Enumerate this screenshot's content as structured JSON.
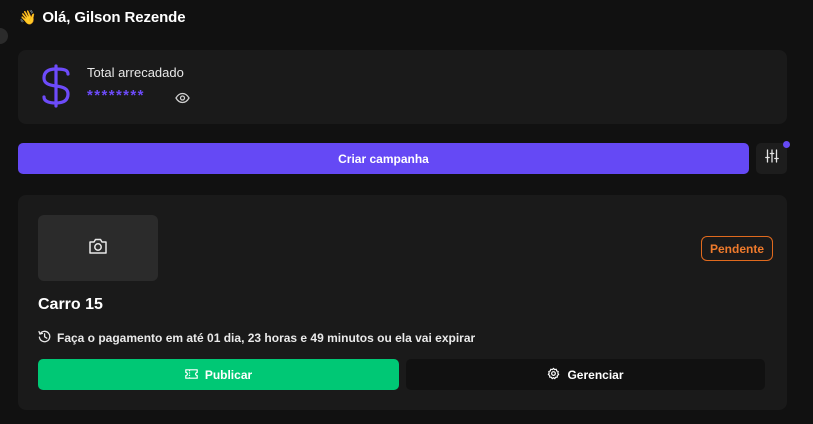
{
  "greeting": {
    "emoji": "👋",
    "text": "Olá, Gilson Rezende"
  },
  "balance": {
    "label": "Total arrecadado",
    "masked_value": "********",
    "icon": "dollar-icon",
    "toggle_icon": "eye-icon"
  },
  "actions": {
    "create_label": "Criar campanha",
    "filter_icon": "sliders-icon",
    "filter_indicator_color": "#6549f5"
  },
  "campaign": {
    "thumbnail_icon": "camera-icon",
    "status": "Pendente",
    "title": "Carro 15",
    "deadline_icon": "history-icon",
    "deadline_text": "Faça o pagamento em até 01 dia, 23 horas e 49 minutos ou ela vai expirar",
    "publish_label": "Publicar",
    "publish_icon": "ticket-icon",
    "manage_label": "Gerenciar",
    "manage_icon": "gear-icon"
  },
  "colors": {
    "accent": "#6549f5",
    "success": "#00c875",
    "pending": "#ee7a2c",
    "background": "#111111",
    "card": "#1a1a1a"
  }
}
